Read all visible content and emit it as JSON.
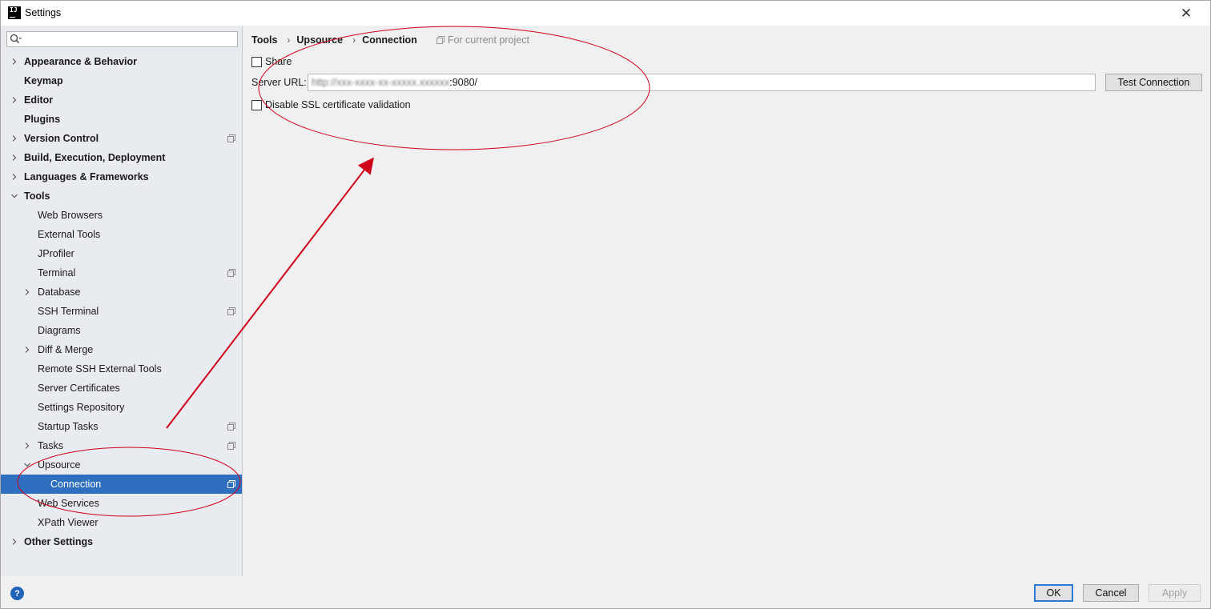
{
  "window": {
    "title": "Settings",
    "app_icon_text": "IJ",
    "close_glyph": "✕"
  },
  "search": {
    "placeholder": "",
    "value": ""
  },
  "sidebar": {
    "items": [
      {
        "label": "Appearance & Behavior",
        "level": 0,
        "bold": true,
        "arrow": "right",
        "project": false
      },
      {
        "label": "Keymap",
        "level": 0,
        "bold": true,
        "arrow": "",
        "project": false
      },
      {
        "label": "Editor",
        "level": 0,
        "bold": true,
        "arrow": "right",
        "project": false
      },
      {
        "label": "Plugins",
        "level": 0,
        "bold": true,
        "arrow": "",
        "project": false
      },
      {
        "label": "Version Control",
        "level": 0,
        "bold": true,
        "arrow": "right",
        "project": true
      },
      {
        "label": "Build, Execution, Deployment",
        "level": 0,
        "bold": true,
        "arrow": "right",
        "project": false
      },
      {
        "label": "Languages & Frameworks",
        "level": 0,
        "bold": true,
        "arrow": "right",
        "project": false
      },
      {
        "label": "Tools",
        "level": 0,
        "bold": true,
        "arrow": "down",
        "project": false
      },
      {
        "label": "Web Browsers",
        "level": 1,
        "bold": false,
        "arrow": "",
        "project": false
      },
      {
        "label": "External Tools",
        "level": 1,
        "bold": false,
        "arrow": "",
        "project": false
      },
      {
        "label": "JProfiler",
        "level": 1,
        "bold": false,
        "arrow": "",
        "project": false
      },
      {
        "label": "Terminal",
        "level": 1,
        "bold": false,
        "arrow": "",
        "project": true
      },
      {
        "label": "Database",
        "level": 1,
        "bold": false,
        "arrow": "right",
        "project": false
      },
      {
        "label": "SSH Terminal",
        "level": 1,
        "bold": false,
        "arrow": "",
        "project": true
      },
      {
        "label": "Diagrams",
        "level": 1,
        "bold": false,
        "arrow": "",
        "project": false
      },
      {
        "label": "Diff & Merge",
        "level": 1,
        "bold": false,
        "arrow": "right",
        "project": false
      },
      {
        "label": "Remote SSH External Tools",
        "level": 1,
        "bold": false,
        "arrow": "",
        "project": false
      },
      {
        "label": "Server Certificates",
        "level": 1,
        "bold": false,
        "arrow": "",
        "project": false
      },
      {
        "label": "Settings Repository",
        "level": 1,
        "bold": false,
        "arrow": "",
        "project": false
      },
      {
        "label": "Startup Tasks",
        "level": 1,
        "bold": false,
        "arrow": "",
        "project": true
      },
      {
        "label": "Tasks",
        "level": 1,
        "bold": false,
        "arrow": "right",
        "project": true
      },
      {
        "label": "Upsource",
        "level": 1,
        "bold": false,
        "arrow": "down",
        "project": false
      },
      {
        "label": "Connection",
        "level": 2,
        "bold": false,
        "arrow": "",
        "project": true,
        "selected": true
      },
      {
        "label": "Web Services",
        "level": 1,
        "bold": false,
        "arrow": "",
        "project": false
      },
      {
        "label": "XPath Viewer",
        "level": 1,
        "bold": false,
        "arrow": "",
        "project": false
      },
      {
        "label": "Other Settings",
        "level": 0,
        "bold": true,
        "arrow": "right",
        "project": false
      }
    ]
  },
  "breadcrumb": {
    "items": [
      "Tools",
      "Upsource",
      "Connection"
    ],
    "separator": "›",
    "scope": "For current project"
  },
  "form": {
    "share_label": "Share",
    "share_checked": false,
    "server_url_label": "Server URL:",
    "server_url_value_hidden": "http://xxx-xxxx-xx-xxxxx.xxxxxx",
    "server_url_value_visible": ":9080/",
    "test_connection_label": "Test Connection",
    "ssl_label": "Disable SSL certificate validation",
    "ssl_checked": false
  },
  "footer": {
    "help_label": "?",
    "ok_label": "OK",
    "cancel_label": "Cancel",
    "apply_label": "Apply"
  },
  "colors": {
    "selection": "#2e6fbf",
    "annotation_red": "#d0021b",
    "sidebar_bg": "#e8ebef",
    "panel_bg": "#f0f0f0"
  }
}
